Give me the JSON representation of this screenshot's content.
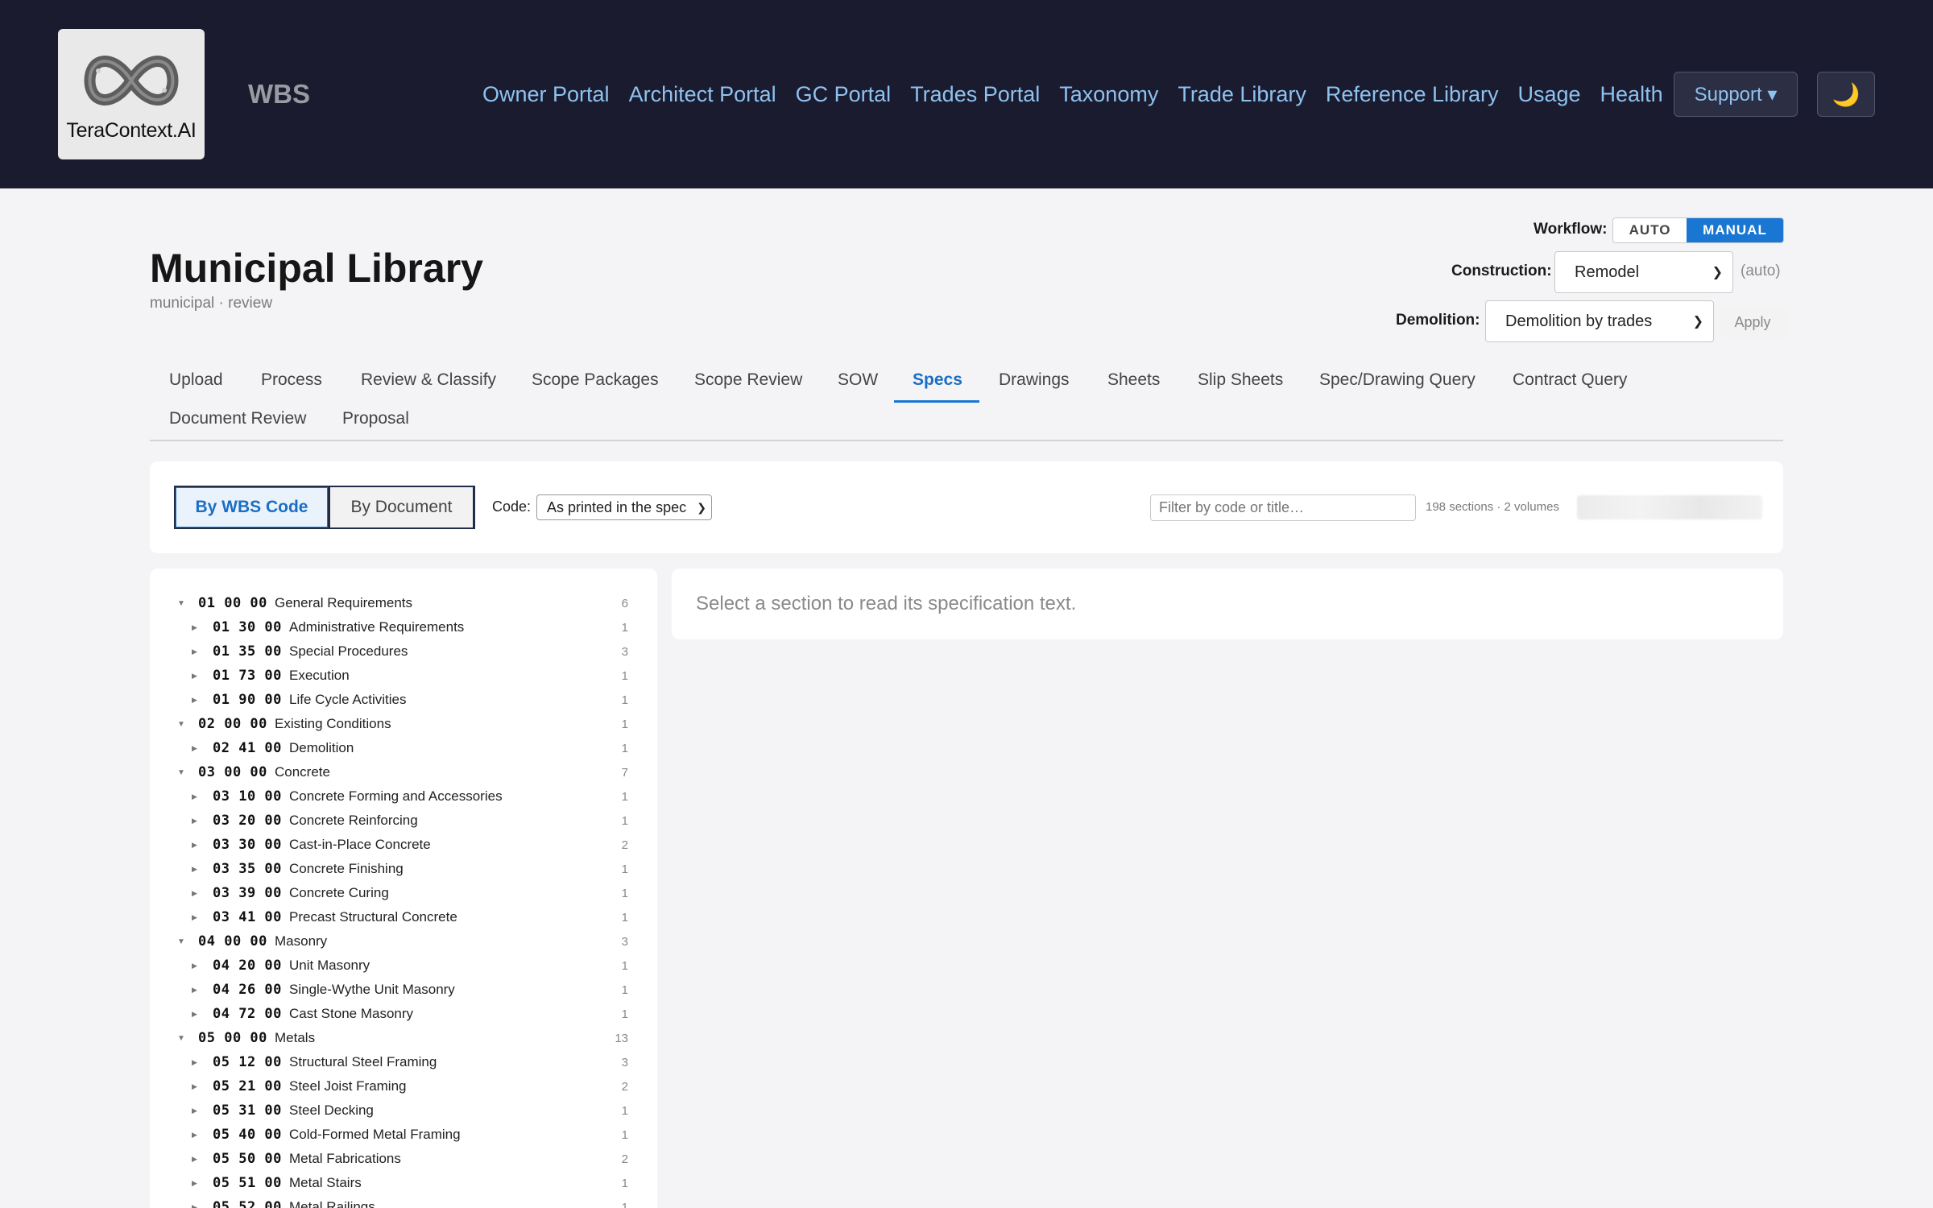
{
  "header": {
    "logo_text": "TeraContext.AI",
    "brand": "WBS",
    "nav": [
      "Owner Portal",
      "Architect Portal",
      "GC Portal",
      "Trades Portal",
      "Taxonomy",
      "Trade Library",
      "Reference Library",
      "Usage",
      "Health"
    ],
    "support_label": "Support ▾",
    "theme_icon": "moon-icon"
  },
  "page": {
    "title": "Municipal Library",
    "subtitle": "municipal · review"
  },
  "workflow": {
    "label": "Workflow:",
    "options": [
      "AUTO",
      "MANUAL"
    ],
    "selected": "MANUAL"
  },
  "construction": {
    "label": "Construction:",
    "value": "Remodel",
    "note": "(auto)"
  },
  "demolition": {
    "label": "Demolition:",
    "value": "Demolition by trades",
    "apply_label": "Apply"
  },
  "tabs": [
    "Upload",
    "Process",
    "Review & Classify",
    "Scope Packages",
    "Scope Review",
    "SOW",
    "Specs",
    "Drawings",
    "Sheets",
    "Slip Sheets",
    "Spec/Drawing Query",
    "Contract Query",
    "Document Review",
    "Proposal"
  ],
  "active_tab": "Specs",
  "toolbar": {
    "by_wbs": "By WBS Code",
    "by_document": "By Document",
    "code_label": "Code:",
    "code_value": "As printed in the spec",
    "filter_placeholder": "Filter by code or title…",
    "stats": "198 sections · 2 volumes"
  },
  "tree": [
    {
      "level": 0,
      "code": "01 00 00",
      "title": "General Requirements",
      "count": "6"
    },
    {
      "level": 1,
      "code": "01 30 00",
      "title": "Administrative Requirements",
      "count": "1"
    },
    {
      "level": 1,
      "code": "01 35 00",
      "title": "Special Procedures",
      "count": "3"
    },
    {
      "level": 1,
      "code": "01 73 00",
      "title": "Execution",
      "count": "1"
    },
    {
      "level": 1,
      "code": "01 90 00",
      "title": "Life Cycle Activities",
      "count": "1"
    },
    {
      "level": 0,
      "code": "02 00 00",
      "title": "Existing Conditions",
      "count": "1"
    },
    {
      "level": 1,
      "code": "02 41 00",
      "title": "Demolition",
      "count": "1"
    },
    {
      "level": 0,
      "code": "03 00 00",
      "title": "Concrete",
      "count": "7"
    },
    {
      "level": 1,
      "code": "03 10 00",
      "title": "Concrete Forming and Accessories",
      "count": "1"
    },
    {
      "level": 1,
      "code": "03 20 00",
      "title": "Concrete Reinforcing",
      "count": "1"
    },
    {
      "level": 1,
      "code": "03 30 00",
      "title": "Cast-in-Place Concrete",
      "count": "2"
    },
    {
      "level": 1,
      "code": "03 35 00",
      "title": "Concrete Finishing",
      "count": "1"
    },
    {
      "level": 1,
      "code": "03 39 00",
      "title": "Concrete Curing",
      "count": "1"
    },
    {
      "level": 1,
      "code": "03 41 00",
      "title": "Precast Structural Concrete",
      "count": "1"
    },
    {
      "level": 0,
      "code": "04 00 00",
      "title": "Masonry",
      "count": "3"
    },
    {
      "level": 1,
      "code": "04 20 00",
      "title": "Unit Masonry",
      "count": "1"
    },
    {
      "level": 1,
      "code": "04 26 00",
      "title": "Single-Wythe Unit Masonry",
      "count": "1"
    },
    {
      "level": 1,
      "code": "04 72 00",
      "title": "Cast Stone Masonry",
      "count": "1"
    },
    {
      "level": 0,
      "code": "05 00 00",
      "title": "Metals",
      "count": "13"
    },
    {
      "level": 1,
      "code": "05 12 00",
      "title": "Structural Steel Framing",
      "count": "3"
    },
    {
      "level": 1,
      "code": "05 21 00",
      "title": "Steel Joist Framing",
      "count": "2"
    },
    {
      "level": 1,
      "code": "05 31 00",
      "title": "Steel Decking",
      "count": "1"
    },
    {
      "level": 1,
      "code": "05 40 00",
      "title": "Cold-Formed Metal Framing",
      "count": "1"
    },
    {
      "level": 1,
      "code": "05 50 00",
      "title": "Metal Fabrications",
      "count": "2"
    },
    {
      "level": 1,
      "code": "05 51 00",
      "title": "Metal Stairs",
      "count": "1"
    },
    {
      "level": 1,
      "code": "05 52 00",
      "title": "Metal Railings",
      "count": "1"
    }
  ],
  "detail": {
    "empty_message": "Select a section to read its specification text."
  },
  "colors": {
    "header_bg": "#1b1b2f",
    "nav_link": "#8ec2ef",
    "accent": "#1976d2"
  }
}
